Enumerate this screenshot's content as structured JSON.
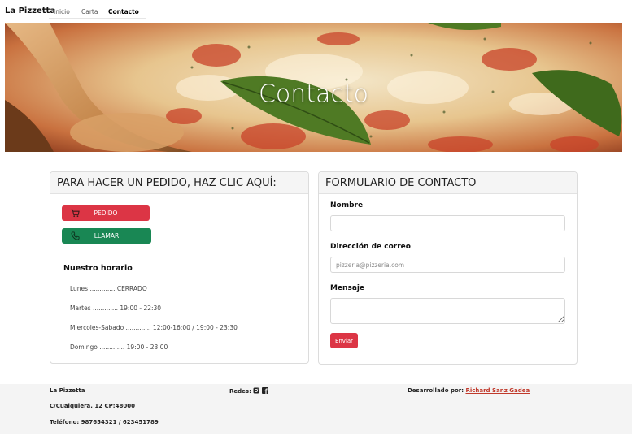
{
  "navbar": {
    "brand": "La Pizzetta",
    "links": [
      {
        "label": "Inicio",
        "active": false
      },
      {
        "label": "Carta",
        "active": false
      },
      {
        "label": "Contacto",
        "active": true
      }
    ]
  },
  "hero": {
    "title": "Contacto"
  },
  "order_card": {
    "header": "PARA HACER UN PEDIDO, HAZ CLIC AQUÍ:",
    "order_button": "PEDIDO",
    "call_button": "LLAMAR",
    "schedule_title": "Nuestro horario",
    "schedule": [
      "Lunes ............. CERRADO",
      "Martes ............. 19:00 - 22:30",
      "Miercoles-Sabado ............. 12:00-16:00 / 19:00 - 23:30",
      "Domingo ............. 19:00 - 23:00"
    ]
  },
  "contact_form": {
    "header": "FORMULARIO DE CONTACTO",
    "name_label": "Nombre",
    "name_value": "",
    "email_label": "Dirección de correo",
    "email_placeholder": "pizzeria@pizzeria.com",
    "message_label": "Mensaje",
    "message_value": "",
    "submit_label": "Enviar"
  },
  "footer": {
    "name": "La Pizzetta",
    "address": "C/Cualquiera, 12 CP:48000",
    "phone": "Teléfono: 987654321 / 623451789",
    "social_label": "Redes:",
    "credit_label": "Desarrollado por:",
    "credit_author": "Richard Sanz Gadea"
  },
  "colors": {
    "danger": "#dc3545",
    "success": "#198754",
    "footer_bg": "#f4f4f4"
  },
  "icons": [
    "cart-icon",
    "phone-icon",
    "instagram-icon",
    "facebook-icon"
  ]
}
